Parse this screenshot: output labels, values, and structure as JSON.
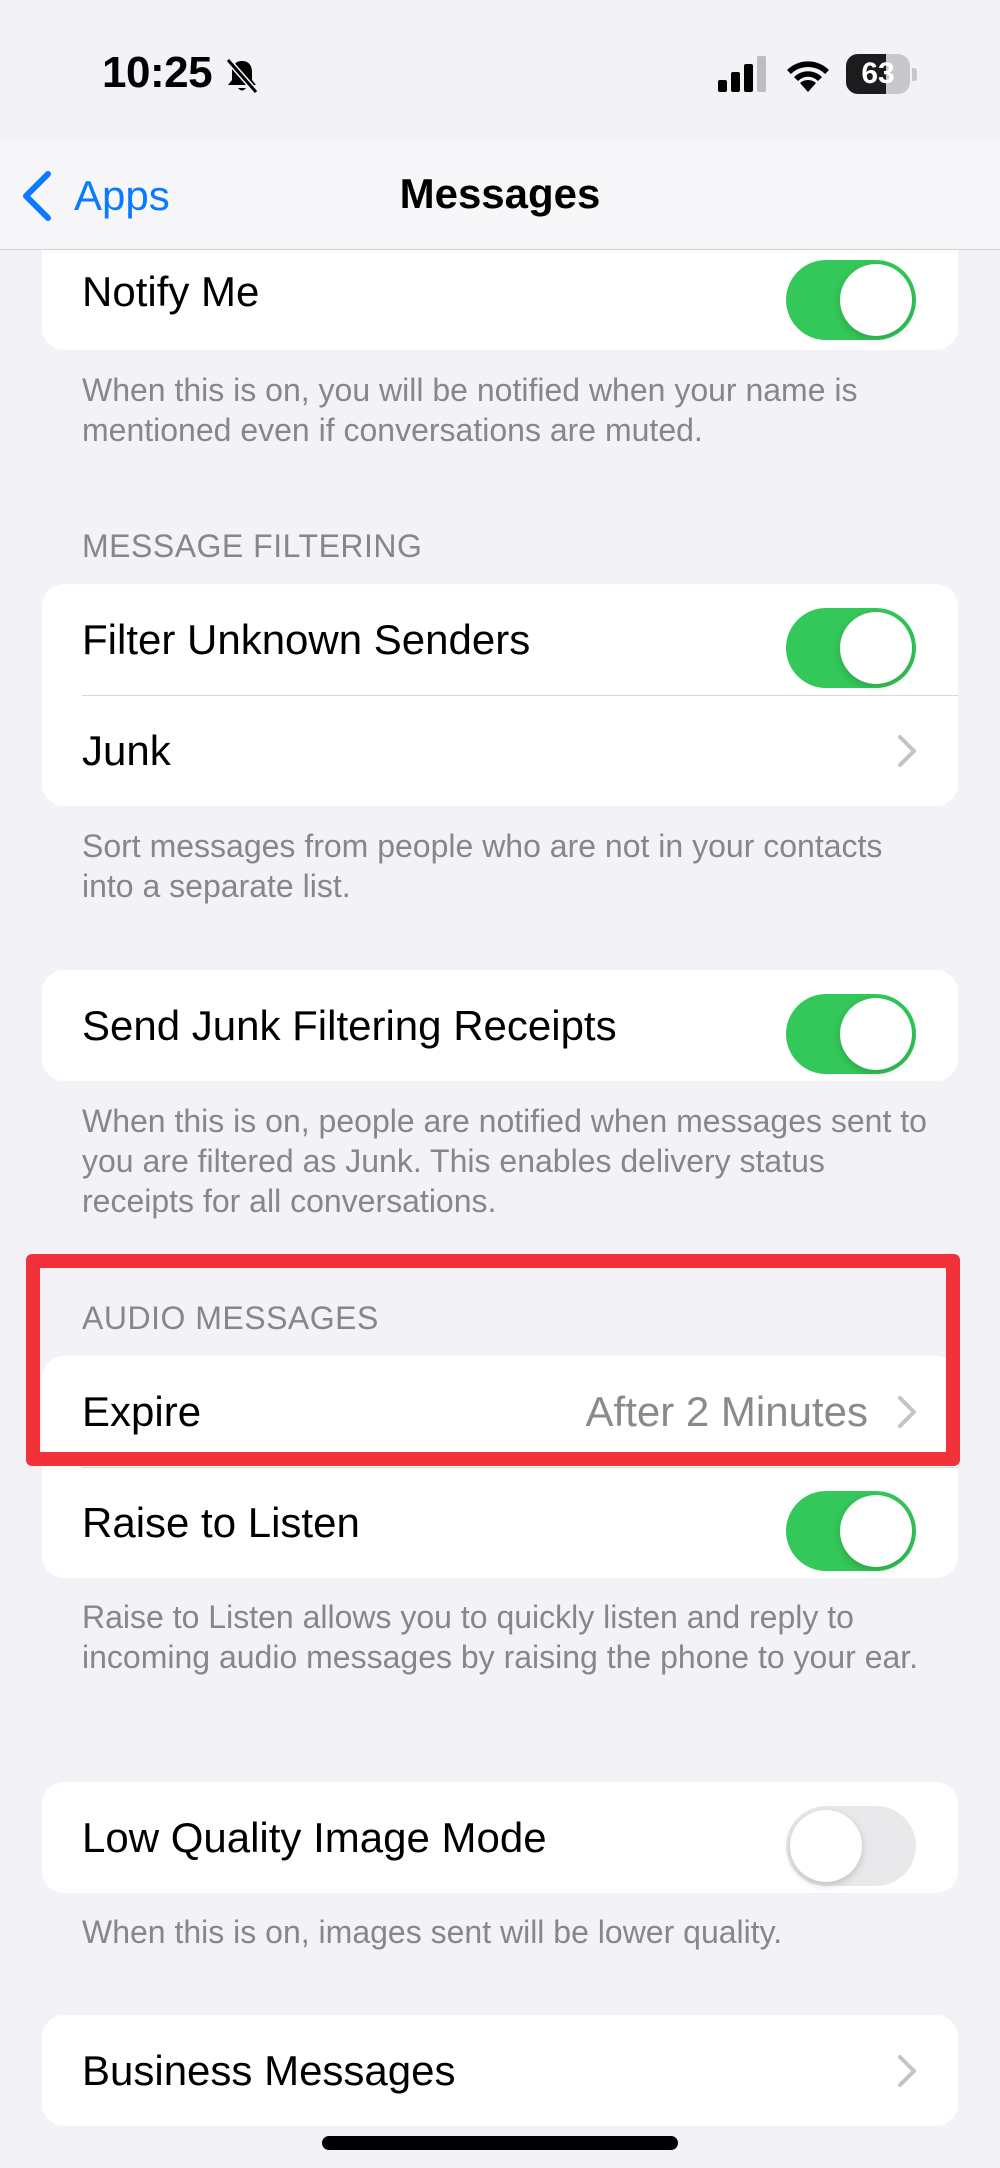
{
  "status": {
    "time": "10:25",
    "battery_level": "63",
    "battery_fraction": 0.63
  },
  "nav": {
    "back_label": "Apps",
    "title": "Messages"
  },
  "sections": {
    "notify": {
      "label": "Notify Me",
      "toggle_on": true,
      "footer": "When this is on, you will be notified when your name is mentioned even if conversations are muted."
    },
    "filtering": {
      "header": "MESSAGE FILTERING",
      "filter_unknown": {
        "label": "Filter Unknown Senders",
        "toggle_on": true
      },
      "junk": {
        "label": "Junk"
      },
      "footer": "Sort messages from people who are not in your contacts into a separate list."
    },
    "receipts": {
      "label": "Send Junk Filtering Receipts",
      "toggle_on": true,
      "footer": "When this is on, people are notified when messages sent to you are filtered as Junk. This enables delivery status receipts for all conversations."
    },
    "audio": {
      "header": "AUDIO MESSAGES",
      "expire": {
        "label": "Expire",
        "value": "After 2 Minutes"
      },
      "raise": {
        "label": "Raise to Listen",
        "toggle_on": true
      },
      "footer": "Raise to Listen allows you to quickly listen and reply to incoming audio messages by raising the phone to your ear."
    },
    "low_quality": {
      "label": "Low Quality Image Mode",
      "toggle_on": false,
      "footer": "When this is on, images sent will be lower quality."
    },
    "business": {
      "label": "Business Messages"
    }
  },
  "colors": {
    "accent": "#0a7aff",
    "toggle_on": "#34c759",
    "highlight": "#f2323a"
  }
}
